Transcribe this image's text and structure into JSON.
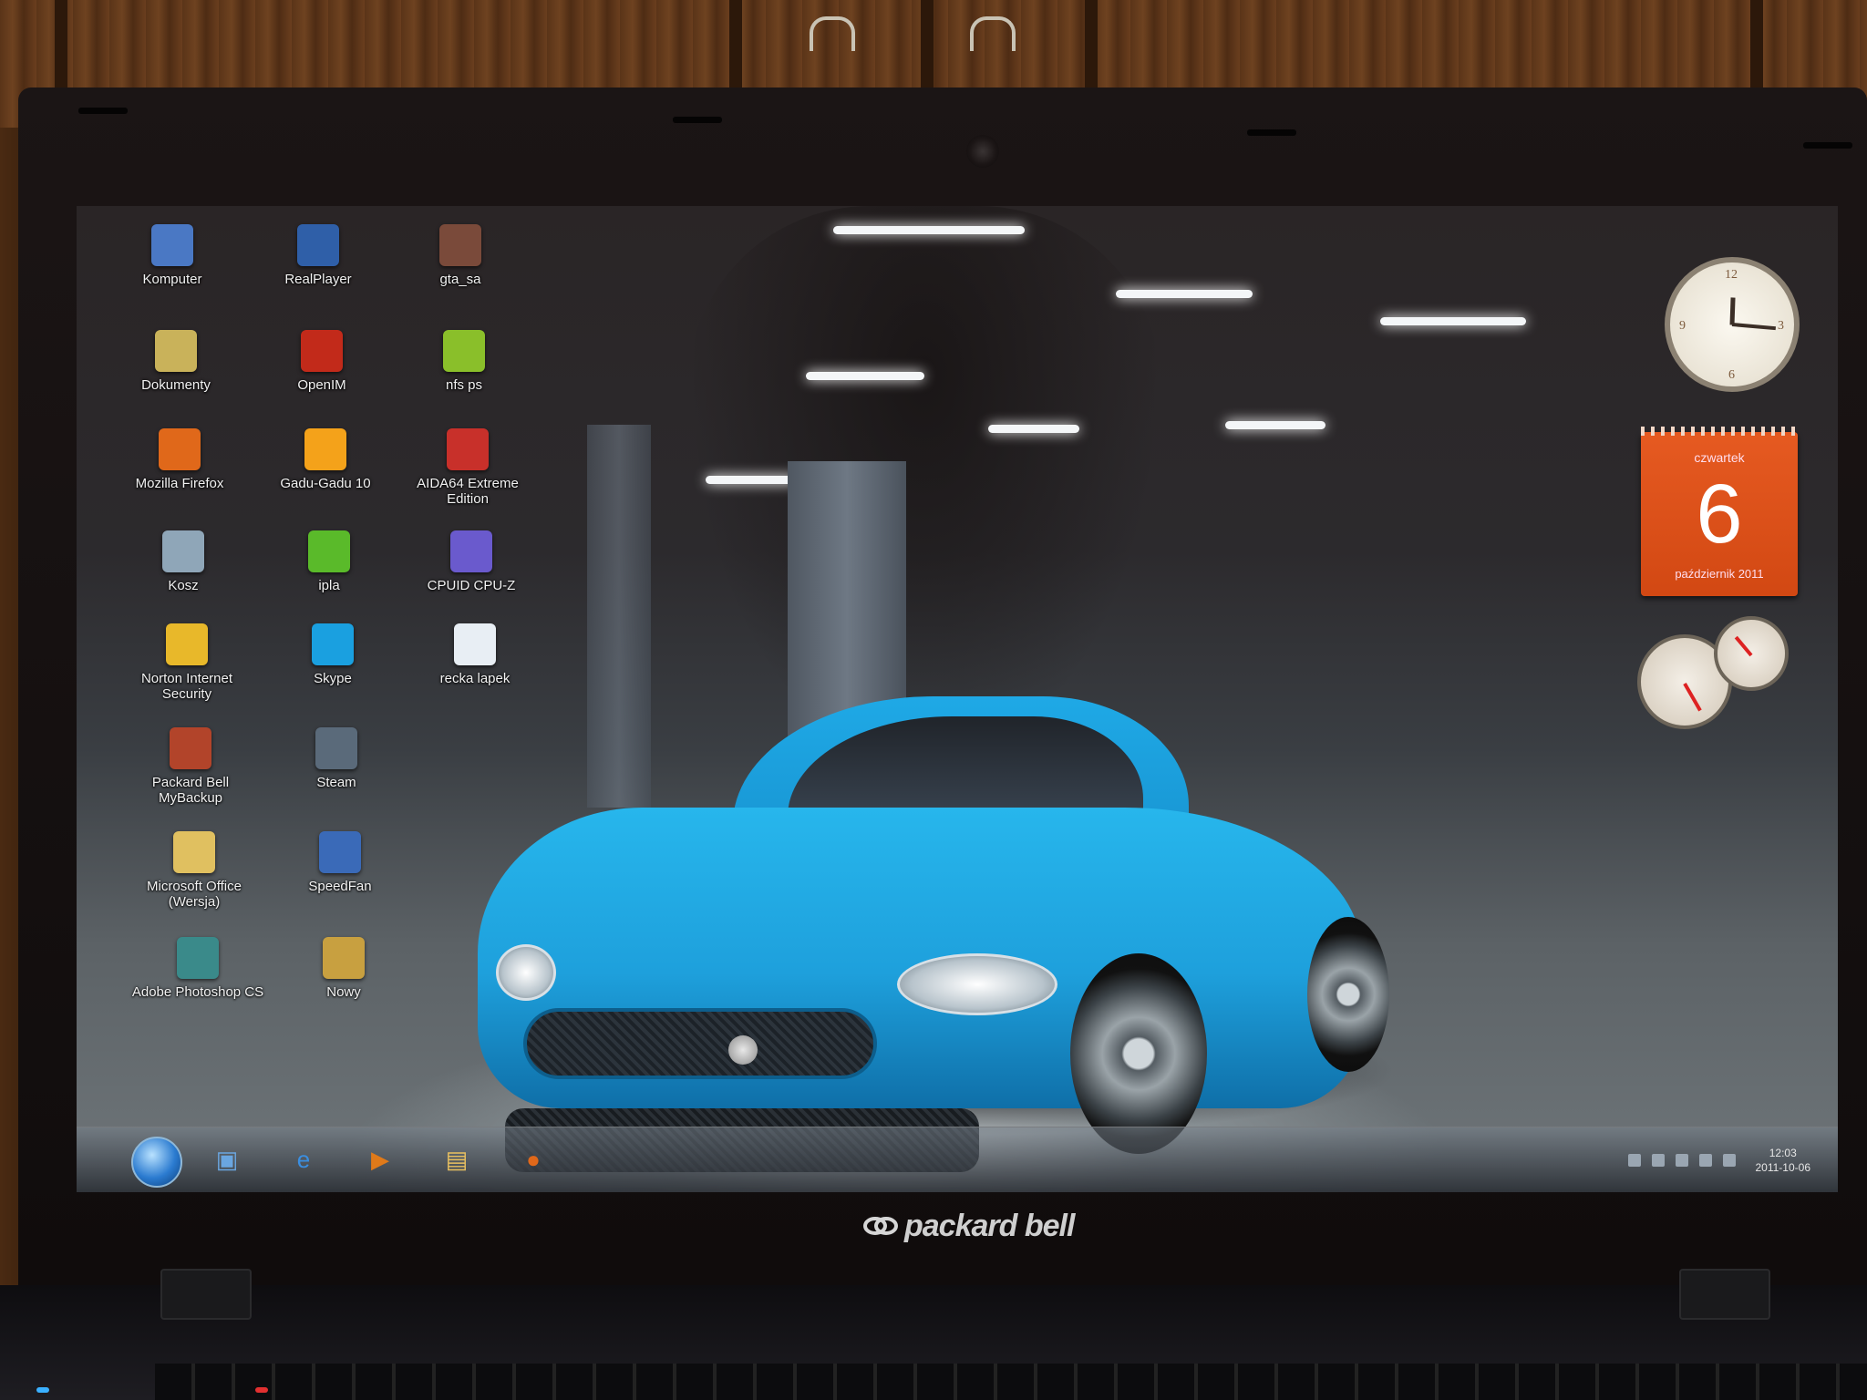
{
  "brand": {
    "name": "packard bell"
  },
  "desktop_icons": [
    {
      "label": "Komputer",
      "icon": "computer-icon",
      "color": "#4a78c4"
    },
    {
      "label": "RealPlayer",
      "icon": "realplayer-icon",
      "color": "#2f5fa8"
    },
    {
      "label": "gta_sa",
      "icon": "gta-icon",
      "color": "#7a4a3a"
    },
    {
      "label": "Dokumenty",
      "icon": "documents-icon",
      "color": "#c9b25a"
    },
    {
      "label": "OpenIM",
      "icon": "openim-icon",
      "color": "#c22a1a"
    },
    {
      "label": "nfs ps",
      "icon": "nfs-icon",
      "color": "#8abf2a"
    },
    {
      "label": "Mozilla Firefox",
      "icon": "firefox-icon",
      "color": "#e0681a"
    },
    {
      "label": "Gadu-Gadu 10",
      "icon": "gadu-gadu-icon",
      "color": "#f4a21a"
    },
    {
      "label": "AIDA64 Extreme Edition",
      "icon": "aida64-icon",
      "color": "#c8302a"
    },
    {
      "label": "Kosz",
      "icon": "recycle-bin-icon",
      "color": "#8fa6b8"
    },
    {
      "label": "ipla",
      "icon": "ipla-icon",
      "color": "#5aba2a"
    },
    {
      "label": "CPUID CPU-Z",
      "icon": "cpuz-icon",
      "color": "#6a5acd"
    },
    {
      "label": "Norton Internet Security",
      "icon": "norton-icon",
      "color": "#e8b82a"
    },
    {
      "label": "Skype",
      "icon": "skype-icon",
      "color": "#1aa0e0"
    },
    {
      "label": "recka lapek",
      "icon": "document-file-icon",
      "color": "#e8eef4"
    },
    {
      "label": "Packard Bell MyBackup",
      "icon": "mybackup-icon",
      "color": "#b2442a"
    },
    {
      "label": "Steam",
      "icon": "steam-icon",
      "color": "#5a6a7a"
    },
    {
      "label": "Microsoft Office (Wersja)",
      "icon": "office-folder-icon",
      "color": "#e0c060"
    },
    {
      "label": "SpeedFan",
      "icon": "speedfan-icon",
      "color": "#3a6ab8"
    },
    {
      "label": "Adobe Photoshop CS",
      "icon": "photoshop-icon",
      "color": "#3a8a8a"
    },
    {
      "label": "Nowy",
      "icon": "new-icon",
      "color": "#c8a040"
    }
  ],
  "calendar": {
    "day_name": "czwartek",
    "day_number": "6",
    "month_year": "październik 2011"
  },
  "taskbar": {
    "pinned": [
      {
        "icon": "explorer-icon",
        "glyph": "▣",
        "color": "#6aa6e0"
      },
      {
        "icon": "internet-explorer-icon",
        "glyph": "e",
        "color": "#3a8ee0"
      },
      {
        "icon": "media-player-icon",
        "glyph": "▶",
        "color": "#e07a1a"
      },
      {
        "icon": "folder-icon",
        "glyph": "▤",
        "color": "#e8c060"
      },
      {
        "icon": "firefox-icon",
        "glyph": "●",
        "color": "#e0681a"
      }
    ],
    "clock_time": "12:03",
    "clock_date": "2011-10-06"
  },
  "colors": {
    "accent_calendar": "#e65a21",
    "car_blue": "#1ea0dc"
  }
}
